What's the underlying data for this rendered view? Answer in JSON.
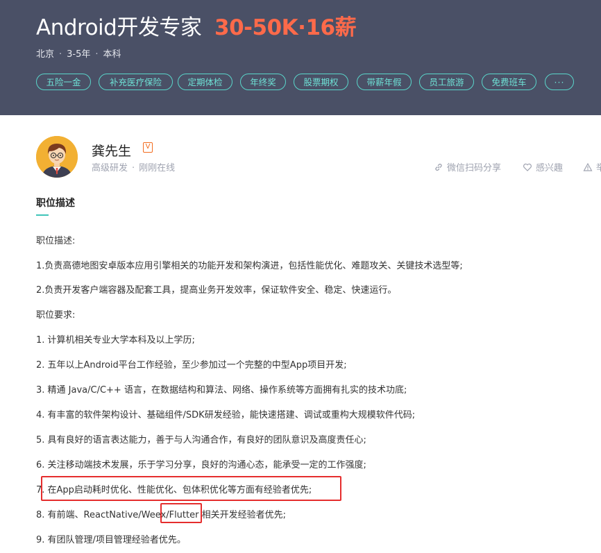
{
  "header": {
    "job_title": "Android开发专家",
    "salary": "30-50K·16薪",
    "meta": {
      "city": "北京",
      "experience": "3-5年",
      "degree": "本科"
    },
    "tags": [
      "五险一金",
      "补充医疗保险",
      "定期体检",
      "年终奖",
      "股票期权",
      "带薪年假",
      "员工旅游",
      "免费班车",
      "···"
    ]
  },
  "recruiter": {
    "name": "龚先生",
    "badge": "V",
    "title": "高级研发",
    "status": "刚刚在线"
  },
  "actions": {
    "share": "微信扫码分享",
    "interest": "感兴趣",
    "report": "举"
  },
  "description": {
    "section_title": "职位描述",
    "lines": [
      "职位描述:",
      "1.负责高德地图安卓版本应用引擎相关的功能开发和架构演进，包括性能优化、难题攻关、关键技术选型等;",
      "2.负责开发客户端容器及配套工具，提高业务开发效率，保证软件安全、稳定、快速运行。",
      "职位要求:",
      "1. 计算机相关专业大学本科及以上学历;",
      "2. 五年以上Android平台工作经验，至少参加过一个完整的中型App项目开发;",
      "3. 精通 Java/C/C++ 语言，在数据结构和算法、网络、操作系统等方面拥有扎实的技术功底;",
      "4. 有丰富的软件架构设计、基础组件/SDK研发经验，能快速搭建、调试或重构大规模软件代码;",
      "5. 具有良好的语言表达能力，善于与人沟通合作，有良好的团队意识及高度责任心;",
      "6. 关注移动端技术发展，乐于学习分享，良好的沟通心态，能承受一定的工作强度;",
      "7. 在App启动耗时优化、性能优化、包体积优化等方面有经验者优先;",
      "8. 有前端、ReactNative/Weex/Flutter 相关开发经验者优先;",
      "9. 有团队管理/项目管理经验者优先。"
    ]
  },
  "colors": {
    "header_bg": "#4a5066",
    "salary": "#fe6a4a",
    "tag": "#5ad6cb",
    "highlight": "#e52d2d"
  }
}
